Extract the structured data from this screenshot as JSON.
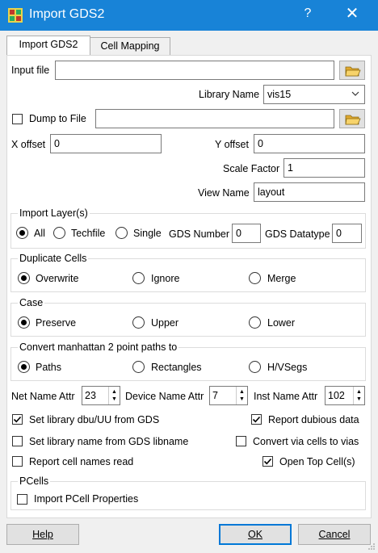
{
  "window": {
    "title": "Import GDS2",
    "help_label": "?",
    "close_label": "✕"
  },
  "tabs": [
    {
      "label": "Import GDS2",
      "active": true
    },
    {
      "label": "Cell Mapping",
      "active": false
    }
  ],
  "form": {
    "input_file_label": "Input file",
    "input_file_value": "",
    "library_name_label": "Library Name",
    "library_name_value": "vis15",
    "dump_to_file_label": "Dump to File",
    "dump_to_file_checked": false,
    "dump_to_file_value": "",
    "x_offset_label": "X offset",
    "x_offset_value": "0",
    "y_offset_label": "Y offset",
    "y_offset_value": "0",
    "scale_factor_label": "Scale Factor",
    "scale_factor_value": "1",
    "view_name_label": "View Name",
    "view_name_value": "layout"
  },
  "import_layers": {
    "title": "Import Layer(s)",
    "options": [
      "All",
      "Techfile",
      "Single"
    ],
    "selected": "All",
    "gds_number_label": "GDS Number",
    "gds_number_value": "0",
    "gds_datatype_label": "GDS Datatype",
    "gds_datatype_value": "0"
  },
  "duplicate_cells": {
    "title": "Duplicate Cells",
    "options": [
      "Overwrite",
      "Ignore",
      "Merge"
    ],
    "selected": "Overwrite"
  },
  "case": {
    "title": "Case",
    "options": [
      "Preserve",
      "Upper",
      "Lower"
    ],
    "selected": "Preserve"
  },
  "manhattan": {
    "title": "Convert manhattan 2 point paths to",
    "options": [
      "Paths",
      "Rectangles",
      "H/VSegs"
    ],
    "selected": "Paths"
  },
  "attrs": {
    "net_name_label": "Net Name Attr",
    "net_name_value": "23",
    "device_name_label": "Device Name Attr",
    "device_name_value": "7",
    "inst_name_label": "Inst Name Attr",
    "inst_name_value": "102"
  },
  "checkboxes": {
    "set_dbu_label": "Set library dbu/UU from GDS",
    "set_dbu_checked": true,
    "report_dubious_label": "Report dubious data",
    "report_dubious_checked": true,
    "set_libname_label": "Set library name from GDS libname",
    "set_libname_checked": false,
    "convert_vias_label": "Convert via cells to vias",
    "convert_vias_checked": false,
    "report_cell_names_label": "Report cell names read",
    "report_cell_names_checked": false,
    "open_top_label": "Open Top Cell(s)",
    "open_top_checked": true
  },
  "pcells": {
    "title": "PCells",
    "import_props_label": "Import PCell Properties",
    "import_props_checked": false
  },
  "buttons": {
    "help": "Help",
    "ok": "OK",
    "cancel": "Cancel"
  },
  "colors": {
    "titlebar": "#1883d7",
    "default_button_border": "#0078d7"
  }
}
